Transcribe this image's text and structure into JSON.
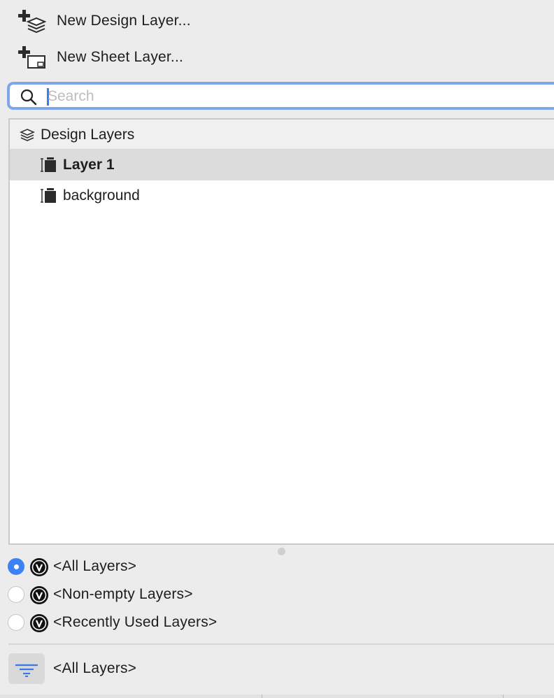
{
  "menu": {
    "new_design_layer": "New Design Layer...",
    "new_sheet_layer": "New Sheet Layer..."
  },
  "search": {
    "placeholder": "Search",
    "value": ""
  },
  "layers": {
    "group_label": "Design Layers",
    "items": [
      {
        "label": "Layer 1",
        "selected": true
      },
      {
        "label": "background",
        "selected": false
      }
    ]
  },
  "filters": {
    "options": [
      {
        "label": "<All Layers>",
        "selected": true
      },
      {
        "label": "<Non-empty Layers>",
        "selected": false
      },
      {
        "label": "<Recently Used Layers>",
        "selected": false
      }
    ],
    "current_label": "<All Layers>"
  },
  "colors": {
    "accent": "#3b82f6",
    "focus_ring": "#7fa6ea",
    "selection": "#dcdcdc"
  }
}
